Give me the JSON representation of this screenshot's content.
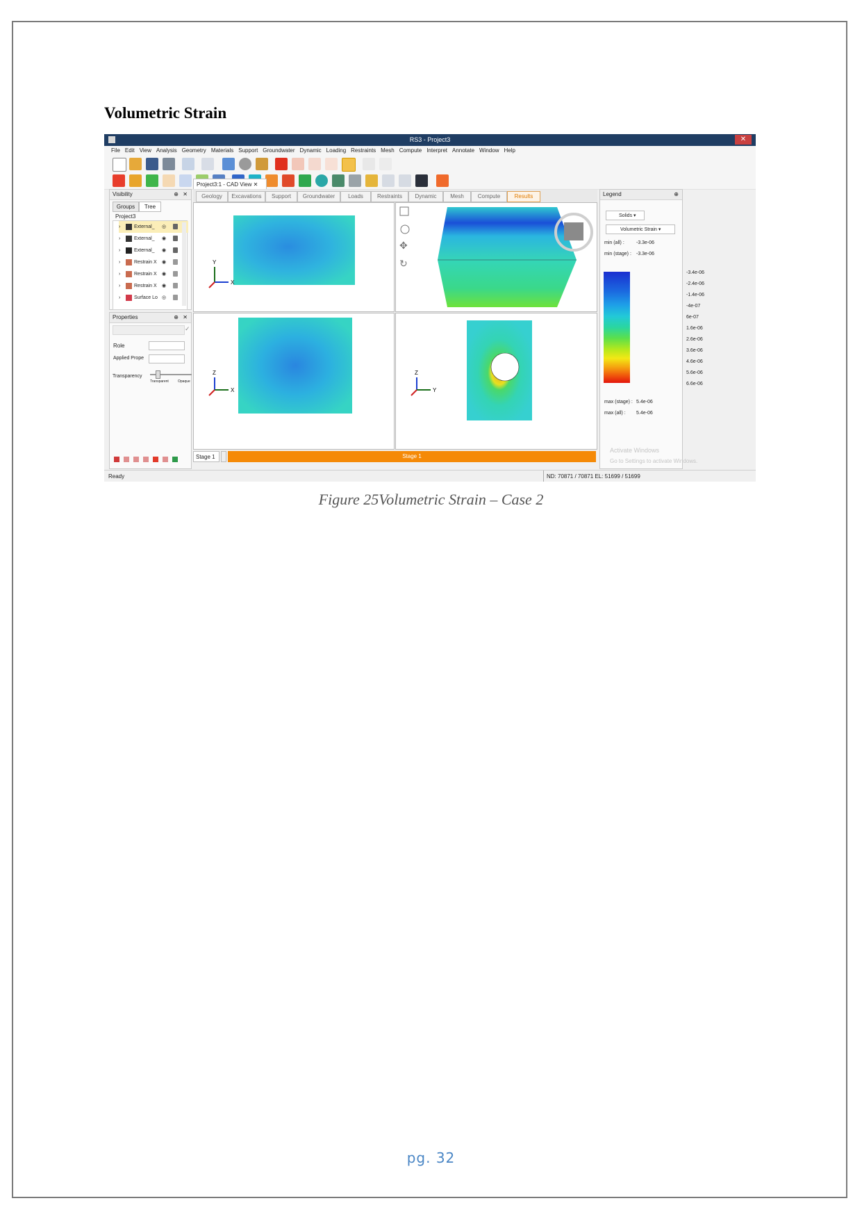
{
  "section_title": "Volumetric Strain",
  "caption": "Figure 25Volumetric Strain – Case 2",
  "page_number": "pg. 32",
  "app": {
    "window_title": "RS3 - Project3",
    "close_glyph": "✕",
    "menu": [
      "File",
      "Edit",
      "View",
      "Analysis",
      "Geometry",
      "Materials",
      "Support",
      "Groundwater",
      "Dynamic",
      "Loading",
      "Restraints",
      "Mesh",
      "Compute",
      "Interpret",
      "Annotate",
      "Window",
      "Help"
    ]
  },
  "visibility_panel": {
    "title": "Visibility",
    "tabs": [
      "Groups",
      "Tree"
    ],
    "root": "Project3",
    "items": [
      {
        "label": "External_",
        "icon": "brush-icon",
        "eye": "◎"
      },
      {
        "label": "External_",
        "icon": "brush-icon",
        "eye": "◉"
      },
      {
        "label": "External_",
        "icon": "terrain-icon",
        "eye": "◉"
      },
      {
        "label": "Restrain X",
        "icon": "restraint-icon",
        "eye": "◉"
      },
      {
        "label": "Restrain X",
        "icon": "restraint-icon",
        "eye": "◉"
      },
      {
        "label": "Restrain X",
        "icon": "restraint-icon",
        "eye": "◉"
      },
      {
        "label": "Surface Lo",
        "icon": "load-icon",
        "eye": "◎"
      }
    ]
  },
  "properties_panel": {
    "title": "Properties",
    "role_label": "Role",
    "applied_label": "Applied Prope",
    "transparency_label": "Transparency",
    "transparent_label": "Transparent",
    "opaque_label": "Opaque"
  },
  "document_tab": "Project3:1 - CAD View",
  "workflow_steps": [
    "Geology",
    "Excavations",
    "Support",
    "Groundwater",
    "Loads",
    "Restraints",
    "Dynamic",
    "Mesh",
    "Compute",
    "Results"
  ],
  "active_step": "Results",
  "viewports": {
    "top_left_axes": [
      "Y",
      "X"
    ],
    "bottom_left_axes": [
      "Z",
      "X"
    ],
    "bottom_right_axes": [
      "Z",
      "Y"
    ]
  },
  "legend": {
    "title": "Legend",
    "mode": "Solids",
    "quantity": "Volumetric Strain",
    "min_all_label": "min (all) :",
    "min_all": "-3.3e-06",
    "min_stage_label": "min (stage) :",
    "min_stage": "-3.3e-06",
    "ticks": [
      "-3.4e-06",
      "-2.4e-06",
      "-1.4e-06",
      "-4e-07",
      "6e-07",
      "1.6e-06",
      "2.6e-06",
      "3.6e-06",
      "4.6e-06",
      "5.6e-06",
      "6.6e-06"
    ],
    "max_stage_label": "max (stage) :",
    "max_stage": "5.4e-06",
    "max_all_label": "max (all) :",
    "max_all": "5.4e-06",
    "colors": [
      "#1a2fd0",
      "#1b6be0",
      "#1ea0e8",
      "#22c9d8",
      "#2ad6a0",
      "#5de04a",
      "#b6e81c",
      "#f3e815",
      "#f5a20f",
      "#f05a0c",
      "#e3140c"
    ]
  },
  "stage": {
    "selector": "Stage 1",
    "bar_label": "Stage 1",
    "bar_color": "#f58a07"
  },
  "watermark": {
    "line1": "Activate Windows",
    "line2": "Go to Settings to activate Windows."
  },
  "status": {
    "left": "Ready",
    "right": "ND: 70871 / 70871  EL: 51699 / 51699"
  }
}
